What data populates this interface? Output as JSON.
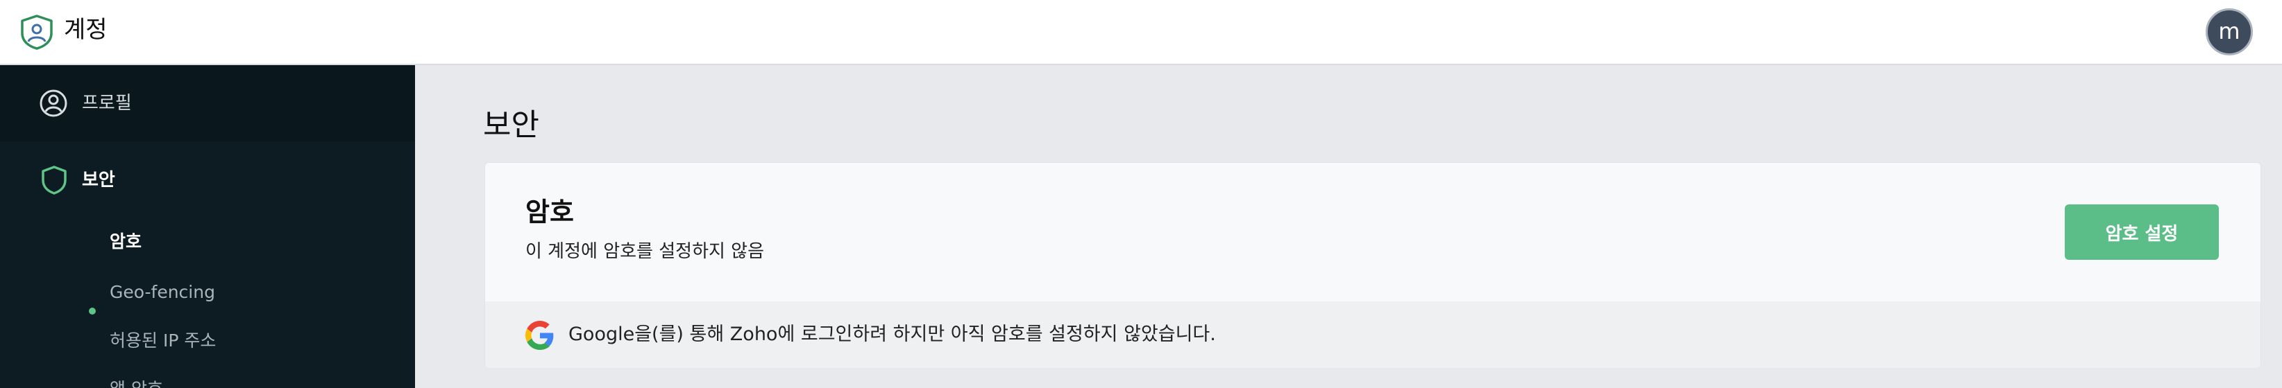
{
  "header": {
    "app_title": "계정",
    "avatar_initial": "m"
  },
  "sidebar": {
    "items": [
      {
        "label": "프로필",
        "icon": "user-circle-icon"
      },
      {
        "label": "보안",
        "icon": "shield-icon",
        "active": true
      }
    ],
    "security_subitems": [
      {
        "label": "암호",
        "active": true
      },
      {
        "label": "Geo-fencing"
      },
      {
        "label": "허용된 IP 주소"
      },
      {
        "label": "앱 암호"
      }
    ]
  },
  "main": {
    "page_title": "보안",
    "password_card": {
      "title": "암호",
      "description": "이 계정에 암호를 설정하지 않음",
      "button_label": "암호 설정",
      "notice": "Google을(를) 통해 Zoho에 로그인하려 하지만 아직 암호를 설정하지 않았습니다.",
      "notice_icon": "google-icon"
    }
  },
  "colors": {
    "accent": "#5bbd87",
    "sidebar_bg": "#0d1c23",
    "content_bg": "#e8e9ec"
  }
}
